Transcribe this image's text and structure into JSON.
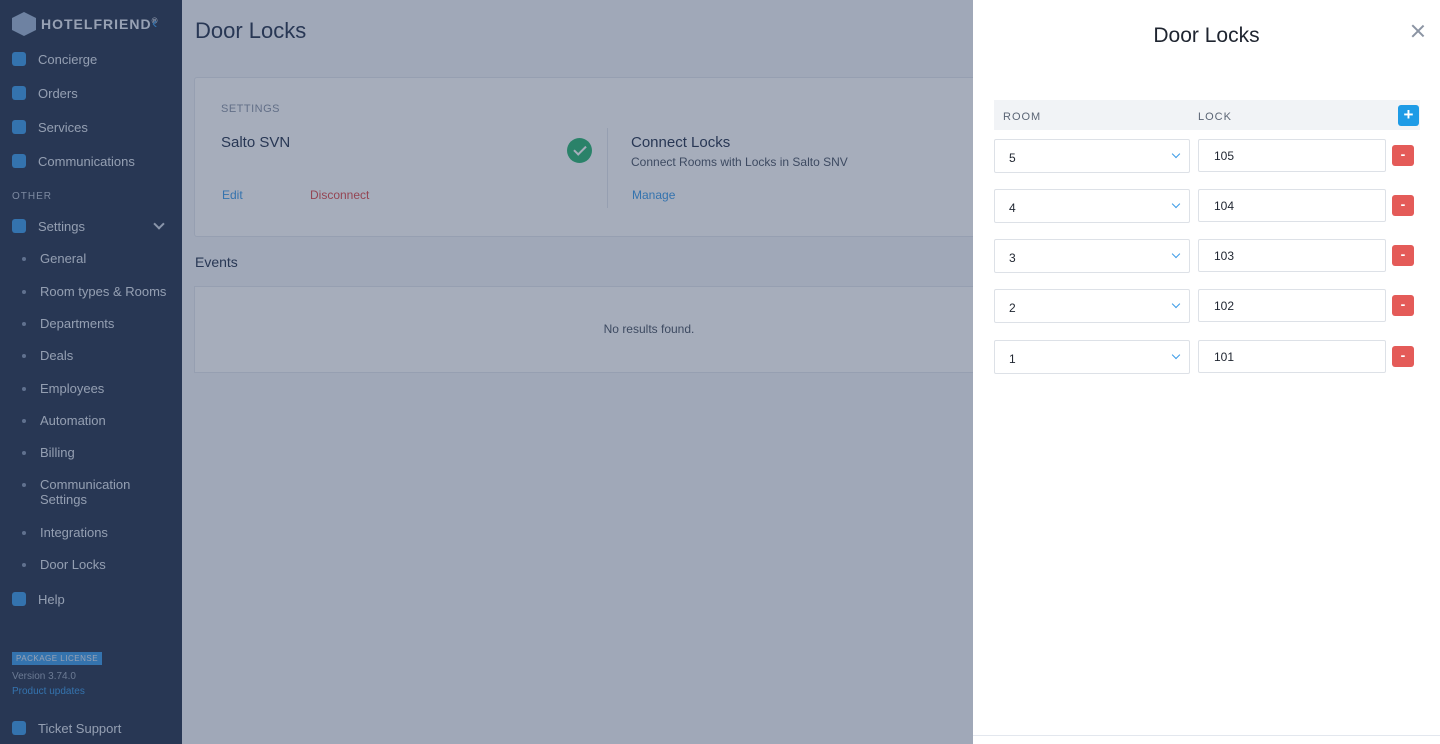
{
  "sidebar": {
    "logo_text": "HOTELFRIEND",
    "logo_mark": "®",
    "nav": [
      {
        "label": "Concierge",
        "icon": "phone-icon"
      },
      {
        "label": "Orders",
        "icon": "cart-icon"
      },
      {
        "label": "Services",
        "icon": "cloche-icon"
      },
      {
        "label": "Communications",
        "icon": "chat-icon"
      }
    ],
    "section_other": "OTHER",
    "settings_label": "Settings",
    "sub_items": [
      "General",
      "Room types & Rooms",
      "Departments",
      "Deals",
      "Employees",
      "Automation",
      "Billing",
      "Communication Settings",
      "Integrations",
      "Door Locks"
    ],
    "help_label": "Help",
    "package_label": "PACKAGE LICENSE",
    "version": "Version 3.74.0",
    "product_updates": "Product updates",
    "ticket_support": "Ticket Support"
  },
  "main": {
    "title": "Door Locks",
    "settings_label": "SETTINGS",
    "service_name": "Salto SVN",
    "edit_label": "Edit",
    "disconnect_label": "Disconnect",
    "connect_title": "Connect Locks",
    "connect_subtitle": "Connect Rooms with Locks in Salto SNV",
    "manage_label": "Manage",
    "events_title": "Events",
    "no_results": "No results found."
  },
  "drawer": {
    "title": "Door Locks",
    "col_room": "ROOM",
    "col_lock": "LOCK",
    "add_label": "+",
    "remove_label": "-",
    "rows": [
      {
        "room": "5",
        "lock": "105"
      },
      {
        "room": "4",
        "lock": "104"
      },
      {
        "room": "3",
        "lock": "103"
      },
      {
        "room": "2",
        "lock": "102"
      },
      {
        "room": "1",
        "lock": "101"
      }
    ]
  },
  "colors": {
    "accent": "#1e9be6",
    "danger": "#e45b58",
    "success": "#2ab673",
    "sidebar": "#26344e"
  }
}
